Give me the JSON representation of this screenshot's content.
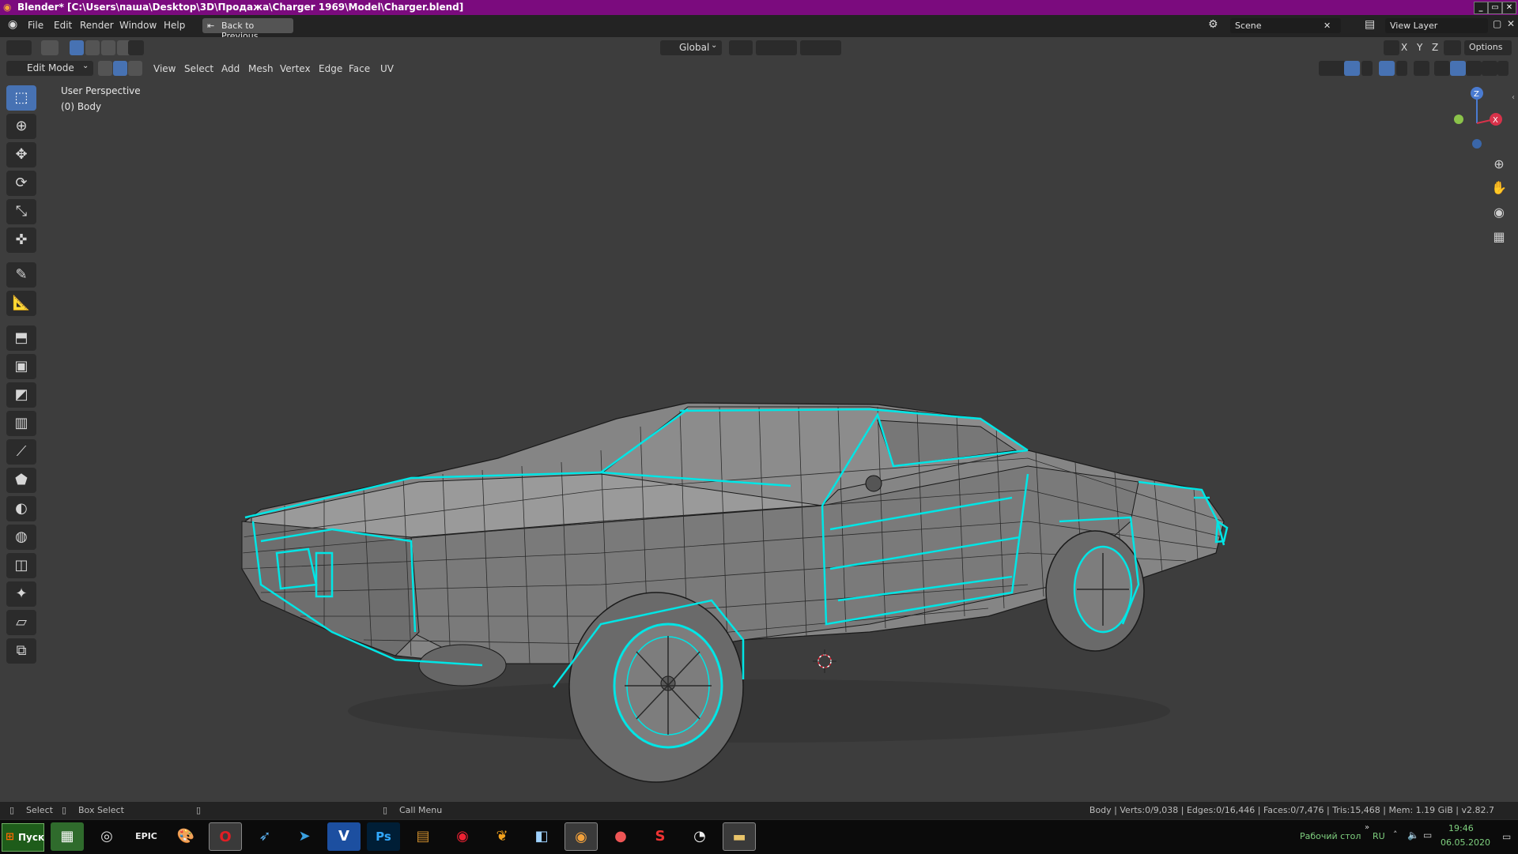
{
  "window": {
    "title": "Blender* [C:\\Users\\паша\\Desktop\\3D\\Продажа\\Charger 1969\\Model\\Charger.blend]",
    "controls": [
      "_",
      "▭",
      "✕"
    ]
  },
  "menubar": {
    "items": [
      "File",
      "Edit",
      "Render",
      "Window",
      "Help"
    ],
    "back_button": "Back to Previous",
    "scene": "Scene",
    "view_layer": "View Layer"
  },
  "tool_header": {
    "transform_orientation": "Global",
    "axes": [
      "X",
      "Y",
      "Z"
    ],
    "options": "Options"
  },
  "mode_header": {
    "mode": "Edit Mode",
    "menus": [
      "View",
      "Select",
      "Add",
      "Mesh",
      "Vertex",
      "Edge",
      "Face",
      "UV"
    ]
  },
  "viewport": {
    "title": "User Perspective",
    "object": "(0) Body",
    "gizmo": {
      "x": "X",
      "y": "Y",
      "z": "Z"
    },
    "accent": "#00e5e5",
    "mesh_color": "#8a8a8a"
  },
  "toolbar": {
    "tools": [
      "select-box",
      "cursor",
      "move",
      "rotate",
      "scale",
      "transform",
      "annotate",
      "measure",
      "extrude",
      "inset",
      "bevel",
      "loop-cut",
      "knife",
      "poly-build",
      "spin",
      "smooth",
      "edge-slide",
      "shrink-fatten",
      "shear",
      "rip"
    ]
  },
  "statusbar": {
    "select": "Select",
    "box_select": "Box Select",
    "call_menu": "Call Menu",
    "stats": "Body | Verts:0/9,038 | Edges:0/16,446 | Faces:0/7,476 | Tris:15,468 | Mem: 1.19 GiB | v2.82.7"
  },
  "taskbar": {
    "start": "Пуск",
    "apps": [
      "explorer",
      "steam",
      "epic-games",
      "paint",
      "opera",
      "feather",
      "telegram",
      "visual-studio",
      "photoshop",
      "winrar",
      "media",
      "fl-studio",
      "notepad",
      "blender",
      "discord-like",
      "substance",
      "octocat",
      "files"
    ],
    "desktop_label": "Рабочий стол",
    "lang": "RU",
    "time": "19:46",
    "date": "06.05.2020"
  }
}
